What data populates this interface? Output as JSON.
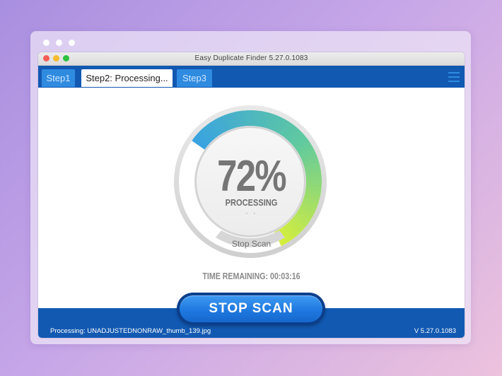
{
  "window": {
    "title": "Easy Duplicate Finder 5.27.0.1083"
  },
  "tabs": [
    {
      "label": "Step1",
      "active": false
    },
    {
      "label": "Step2: Processing...",
      "active": true
    },
    {
      "label": "Step3",
      "active": false
    }
  ],
  "progress": {
    "percent_label": "72%",
    "value": 0.72,
    "status_label": "PROCESSING",
    "dots": "· ·",
    "inner_button_label": "Stop Scan",
    "time_remaining": "TIME REMAINING: 00:03:16"
  },
  "footer": {
    "stop_button_label": "STOP  SCAN",
    "status": "Processing: UNADJUSTEDNONRAW_thumb_139.jpg",
    "version": "V 5.27.0.1083"
  },
  "colors": {
    "tabbar": "#1259b2",
    "accent_blue": "#2f8be0",
    "gauge_start": "#3aa3e0",
    "gauge_mid": "#5fc9a0",
    "gauge_end": "#d8ef3a"
  },
  "icons": [
    "hamburger-menu-icon"
  ]
}
